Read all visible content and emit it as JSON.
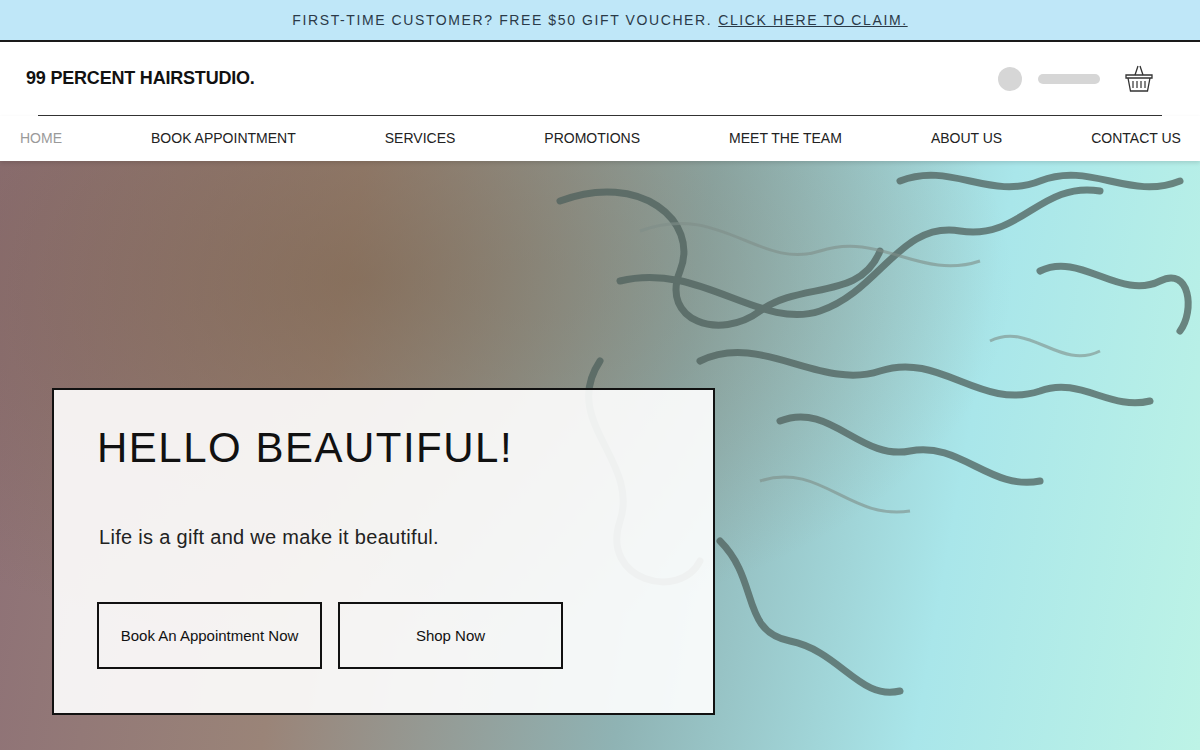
{
  "announcement": {
    "text": "FIRST-TIME CUSTOMER? FREE $50 GIFT VOUCHER.",
    "link": "CLICK HERE TO CLAIM."
  },
  "header": {
    "logo": "99 PERCENT HAIRSTUDIO."
  },
  "nav": [
    {
      "label": "HOME",
      "selected": true
    },
    {
      "label": "BOOK APPOINTMENT",
      "selected": false
    },
    {
      "label": "SERVICES",
      "selected": false
    },
    {
      "label": "PROMOTIONS",
      "selected": false
    },
    {
      "label": "MEET THE TEAM",
      "selected": false
    },
    {
      "label": "ABOUT US",
      "selected": false
    },
    {
      "label": "CONTACT US",
      "selected": false
    }
  ],
  "hero": {
    "title": "HELLO BEAUTIFUL!",
    "subtitle": "Life is a gift and we make it beautiful.",
    "buttons": [
      "Book An Appointment Now",
      "Shop Now"
    ]
  }
}
